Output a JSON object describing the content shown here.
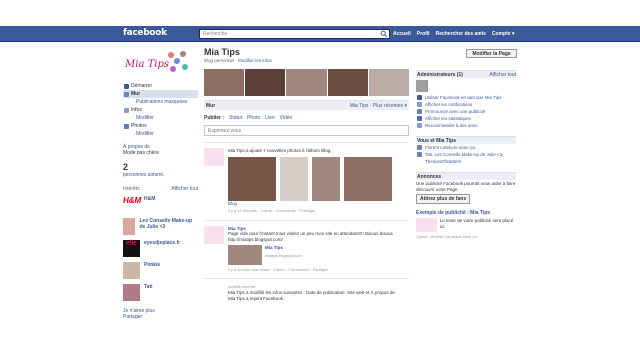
{
  "header": {
    "logo": "facebook",
    "search_placeholder": "Recherche",
    "nav": [
      "Accueil",
      "Profil",
      "Rechercher des amis",
      "Compte ▾"
    ]
  },
  "left": {
    "nav": [
      {
        "label": "Démarrer",
        "sel": false,
        "sub": false
      },
      {
        "label": "Mur",
        "sel": true,
        "sub": false
      },
      {
        "label": "Publications masquées",
        "sel": false,
        "sub": true
      },
      {
        "label": "Infos",
        "sel": false,
        "sub": false
      },
      {
        "label": "Modifier",
        "sel": false,
        "sub": true
      },
      {
        "label": "Photos",
        "sel": false,
        "sub": false
      },
      {
        "label": "Modifier",
        "sel": false,
        "sub": true
      }
    ],
    "about_label": "À propos de",
    "about_value": "Mode pas chère",
    "likes_count": "2",
    "likes_label": "personnes aiment.",
    "interests_title": "Intérêts",
    "interests_action": "Afficher tout",
    "interests": [
      "H&M",
      "Les Conseils Make-up de Julie <3",
      "eyesdjeplace.fr",
      "Pimkie",
      "Tati"
    ],
    "footer1": "Je n'aime plus",
    "footer2": "Partager"
  },
  "main": {
    "title": "Mia Tips",
    "subtitle_cat": "Blog personnel",
    "subtitle_edit": "Modifier les infos",
    "edit_button": "Modifier la Page",
    "wall_title": "Mur",
    "wall_filter": "Mia Tips · Plus récentes ▾",
    "publish_label": "Publier :",
    "publish_types": [
      "Statut",
      "Photo",
      "Lien",
      "Vidéo"
    ],
    "status_placeholder": "Exprimez-vous",
    "story1_head": "Mia Tips a ajouté 7 nouvelles photos à l'album Blog.",
    "story1_album": "Blog",
    "story1_meta": "il y a 15 minutes · J'aime · Commenter · Partager",
    "story2_author": "Mia Tips",
    "story2_text": "Page vide pour l'instant mais visitez un peu mon site en attendant!!!! Bisous bisous http://miatips.blogspot.com/",
    "story2_link_title": "Mia Tips",
    "story2_link_url": "miatips.blogspot.com",
    "story2_meta": "il y a environ une heure · J'aime · Commenter · Partager",
    "recent_title": "Activité récente",
    "recent1": "Mia Tips a modifié les infos suivantes : Date de publication, Site web et À propos de.",
    "recent2": "Mia Tips a rejoint Facebook."
  },
  "right": {
    "admins_title": "Administrateurs (1)",
    "admins_action": "Afficher tout",
    "admin_links": [
      "Utiliser Facebook en tant que Mia Tips",
      "Afficher les notifications",
      "Promouvoir avec une publicité",
      "Afficher les statistiques",
      "Recommander à des amis"
    ],
    "you_title": "Vous et Mia Tips",
    "you_items": [
      "Florent Lefebvre aime ça.",
      "Tati, Les Conseils Make-up de Julie <3, ThesionOfStatters"
    ],
    "ads_title": "Annonces",
    "ads_text": "Une publicité Facebook pourrait vous aider à faire découvrir votre Page.",
    "ads_button": "Attirez plus de fans",
    "example_title": "Exemple de publicité : Mia Tips",
    "example_text": "Le texte de votre publicité sera placé ici.",
    "example_meta": "J'aime · Amélie Carneaux aime ça."
  }
}
